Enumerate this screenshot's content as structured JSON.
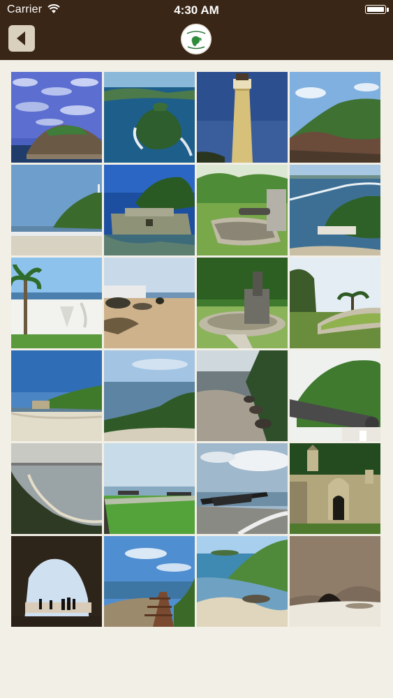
{
  "status_bar": {
    "carrier": "Carrier",
    "time": "4:30 AM"
  },
  "nav": {
    "back_icon": "chevron-left-icon",
    "logo_icon": "app-logo-icon"
  },
  "gallery": {
    "photos": [
      {
        "subject": "island-rock-clouds"
      },
      {
        "subject": "island-aerial"
      },
      {
        "subject": "lighthouse"
      },
      {
        "subject": "green-hill-coast"
      },
      {
        "subject": "beach-hill-lighthouse"
      },
      {
        "subject": "fortress-aerial"
      },
      {
        "subject": "cannon-terrace-trees"
      },
      {
        "subject": "coastline-aerial"
      },
      {
        "subject": "palm-white-wall"
      },
      {
        "subject": "rocks-wall-beach"
      },
      {
        "subject": "cannon-stone-platform"
      },
      {
        "subject": "palms-fort-wall"
      },
      {
        "subject": "beach-sea"
      },
      {
        "subject": "shore-hill"
      },
      {
        "subject": "rocky-beach"
      },
      {
        "subject": "cannon-closeup"
      },
      {
        "subject": "coast-aerial-dusk"
      },
      {
        "subject": "fort-lawn-cannons"
      },
      {
        "subject": "cannons-sea"
      },
      {
        "subject": "fort-gate"
      },
      {
        "subject": "cave-silhouettes"
      },
      {
        "subject": "boardwalk-stairs"
      },
      {
        "subject": "beach-cliff"
      },
      {
        "subject": "rock-cave"
      }
    ]
  }
}
